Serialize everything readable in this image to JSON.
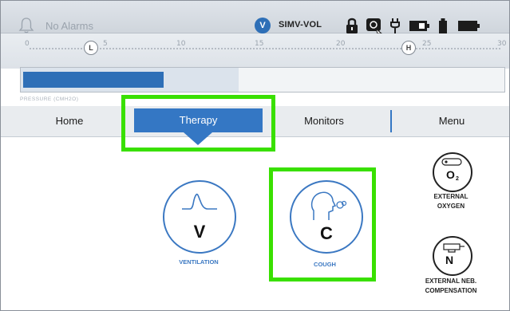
{
  "status_bar": {
    "alarm_text": "No Alarms",
    "mode_badge": "V",
    "mode": "SIMV-VOL",
    "icons": [
      "bell-icon",
      "lock-icon",
      "screen-lock-icon",
      "plug-icon",
      "battery-icon",
      "cylinder-icon",
      "battery-full-icon"
    ]
  },
  "pressure_scale": {
    "ticks": [
      "0",
      "5",
      "10",
      "15",
      "20",
      "25",
      "30"
    ],
    "low_marker": "L",
    "high_marker": "H",
    "label": "PRESSURE (CMH2O)",
    "fill_fraction": 0.29,
    "band_fraction": 0.45
  },
  "tabs": [
    {
      "label": "Home"
    },
    {
      "label": "Therapy"
    },
    {
      "label": "Monitors"
    },
    {
      "label": "Menu"
    }
  ],
  "therapy": {
    "ventilation": {
      "letter": "V",
      "caption": "VENTILATION"
    },
    "cough": {
      "letter": "C",
      "caption": "COUGH"
    },
    "external_oxygen": {
      "symbol": "O",
      "subscript": "2",
      "caption_line1": "EXTERNAL",
      "caption_line2": "OXYGEN"
    },
    "external_neb": {
      "symbol": "N",
      "caption_line1": "EXTERNAL NEB.",
      "caption_line2": "COMPENSATION"
    }
  },
  "colors": {
    "accent": "#3477c4",
    "highlight": "#39e000",
    "header": "#dfe4ea"
  }
}
